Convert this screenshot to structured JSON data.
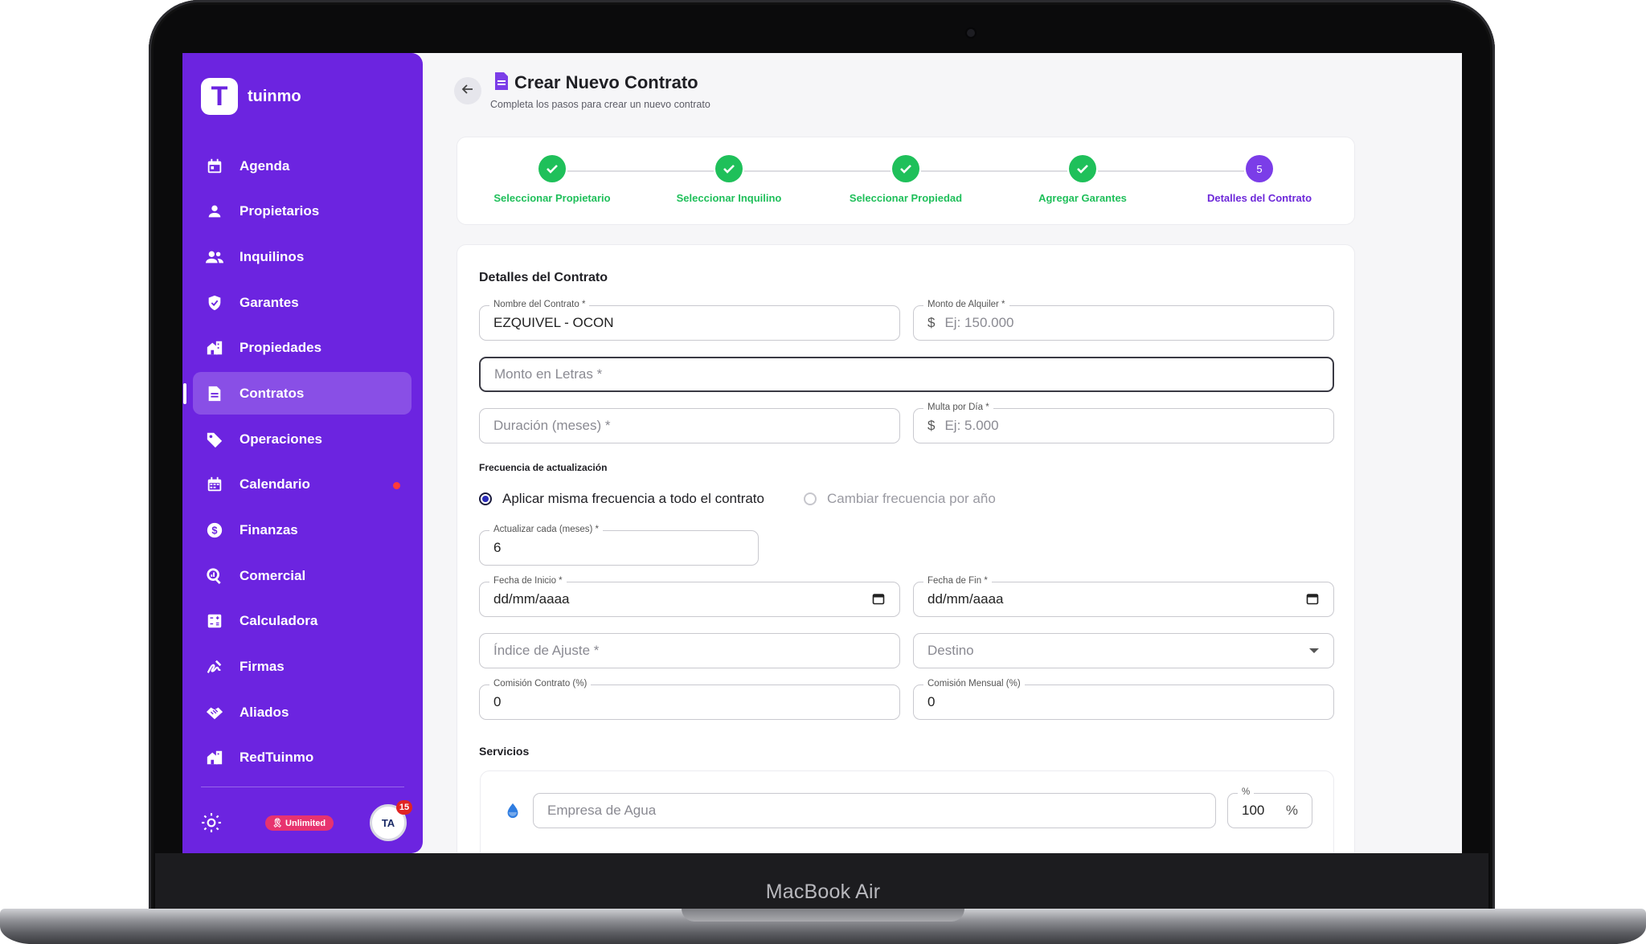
{
  "device": {
    "label": "MacBook Air"
  },
  "sidebar": {
    "brand": "tuinmo",
    "brand_letter": "T",
    "items": [
      {
        "label": "Agenda",
        "icon": "calendar-icon"
      },
      {
        "label": "Propietarios",
        "icon": "person-icon"
      },
      {
        "label": "Inquilinos",
        "icon": "people-icon"
      },
      {
        "label": "Garantes",
        "icon": "shield-check-icon"
      },
      {
        "label": "Propiedades",
        "icon": "buildings-icon"
      },
      {
        "label": "Contratos",
        "icon": "document-icon",
        "active": true
      },
      {
        "label": "Operaciones",
        "icon": "tag-icon"
      },
      {
        "label": "Calendario",
        "icon": "calendar-grid-icon",
        "notification_dot": true
      },
      {
        "label": "Finanzas",
        "icon": "dollar-circle-icon"
      },
      {
        "label": "Comercial",
        "icon": "search-analytics-icon"
      },
      {
        "label": "Calculadora",
        "icon": "calculator-icon"
      },
      {
        "label": "Firmas",
        "icon": "signature-icon"
      },
      {
        "label": "Aliados",
        "icon": "handshake-icon"
      },
      {
        "label": "RedTuinmo",
        "icon": "network-buildings-icon"
      }
    ],
    "footer": {
      "theme_icon": "sun-icon",
      "plan_badge": "Unlimited",
      "avatar_text": "TA",
      "avatar_badge": "15"
    }
  },
  "header": {
    "title": "Crear Nuevo Contrato",
    "subtitle": "Completa los pasos para crear un nuevo contrato"
  },
  "stepper": {
    "steps": [
      {
        "label": "Seleccionar Propietario",
        "status": "done"
      },
      {
        "label": "Seleccionar Inquilino",
        "status": "done"
      },
      {
        "label": "Seleccionar Propiedad",
        "status": "done"
      },
      {
        "label": "Agregar Garantes",
        "status": "done"
      },
      {
        "label": "Detalles del Contrato",
        "status": "current",
        "number": "5"
      }
    ]
  },
  "form": {
    "section_title": "Detalles del Contrato",
    "contract_name": {
      "label": "Nombre del Contrato *",
      "value": "EZQUIVEL - OCON"
    },
    "rent_amount": {
      "label": "Monto de Alquiler *",
      "prefix": "$",
      "placeholder": "Ej: 150.000"
    },
    "amount_words": {
      "placeholder": "Monto en Letras *"
    },
    "duration": {
      "placeholder": "Duración (meses) *"
    },
    "daily_fine": {
      "label": "Multa por Día *",
      "prefix": "$",
      "placeholder": "Ej: 5.000"
    },
    "update_frequency": {
      "title": "Frecuencia de actualización",
      "option_same": "Aplicar misma frecuencia a todo el contrato",
      "option_yearly": "Cambiar frecuencia por año",
      "selected": "same"
    },
    "update_every": {
      "label": "Actualizar cada (meses) *",
      "value": "6"
    },
    "start_date": {
      "label": "Fecha de Inicio *",
      "value": "dd/mm/aaaa"
    },
    "end_date": {
      "label": "Fecha de Fin *",
      "value": "dd/mm/aaaa"
    },
    "adjust_index": {
      "placeholder": "Índice de Ajuste *"
    },
    "destination": {
      "placeholder": "Destino"
    },
    "commission_contract": {
      "label": "Comisión Contrato (%)",
      "value": "0"
    },
    "commission_monthly": {
      "label": "Comisión Mensual (%)",
      "value": "0"
    },
    "services": {
      "title": "Servicios",
      "water": {
        "placeholder": "Empresa de Agua",
        "percent_label": "%",
        "percent_value": "100",
        "percent_suffix": "%"
      }
    }
  },
  "colors": {
    "brand": "#6c24e0",
    "success": "#1fc05a",
    "current_step": "#7b3de8",
    "badge": "#e7336f"
  }
}
